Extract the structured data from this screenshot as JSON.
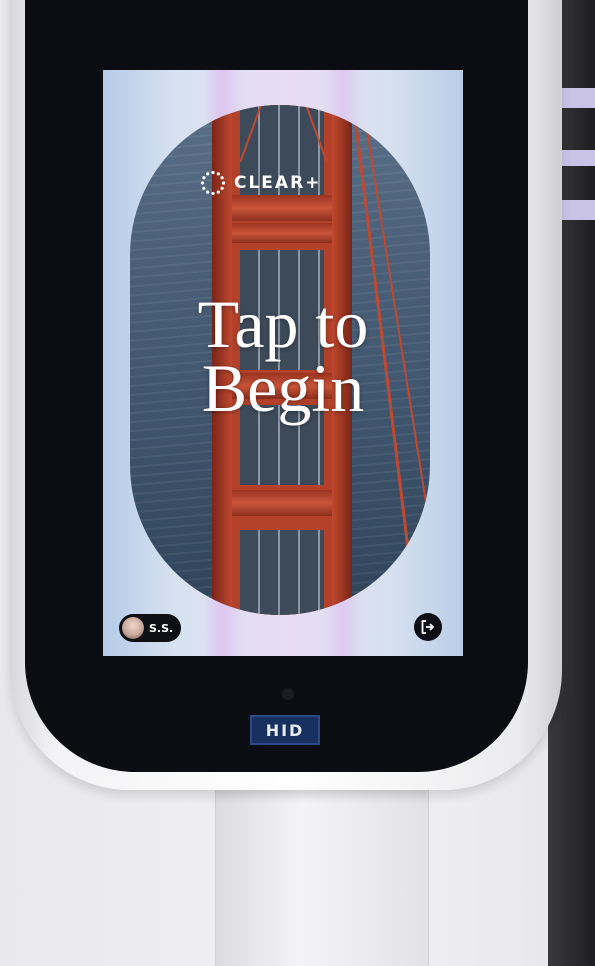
{
  "kiosk": {
    "brand_name": "CLEAR+",
    "brand_icon": "clear-ring-logo-icon",
    "headline_line1": "Tap to",
    "headline_line2": "Begin",
    "user_initials": "S.S.",
    "user_avatar": "user-avatar-icon",
    "exit_icon": "sign-out-icon",
    "hardware_badge": "HID"
  },
  "colors": {
    "screen_bg": "#d7e2f1",
    "accent_purple": "#e9dcf3",
    "bridge_red": "#b3412a",
    "water_blue": "#4a5f78",
    "chip_bg": "#0e0f14",
    "hid_badge_bg": "#17305f"
  }
}
